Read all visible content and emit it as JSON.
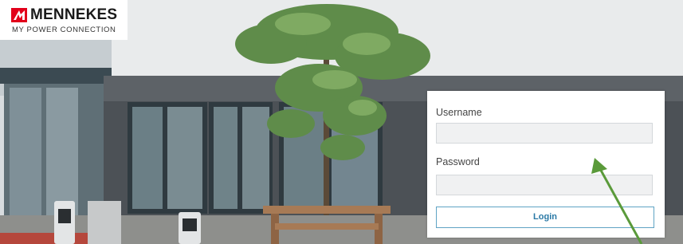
{
  "brand": {
    "name": "MENNEKES",
    "tagline": "MY POWER CONNECTION",
    "accent_color": "#e2001a",
    "logo_icon": "mennekes-logo-icon"
  },
  "login": {
    "username_label": "Username",
    "username_value": "",
    "password_label": "Password",
    "password_value": "",
    "button_label": "Login",
    "accent_color": "#2a79a6"
  },
  "annotation": {
    "icon": "arrow-icon",
    "color": "#5a9a3a"
  }
}
